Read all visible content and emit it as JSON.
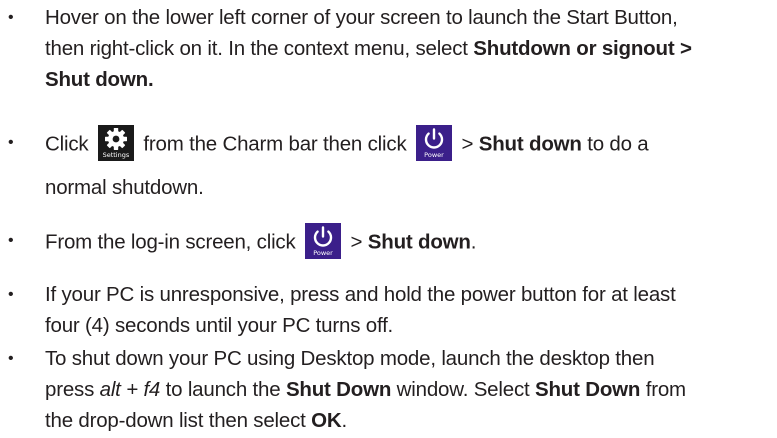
{
  "icons": {
    "settings_tile": "gear-icon",
    "power_tile": "power-icon",
    "settings_tile_color": "#1a1a1a",
    "power_tile_color": "#3b1f8a"
  },
  "items": [
    {
      "bullet": "•",
      "p1": "Hover on the lower left corner of your screen to launch the Start Button,",
      "p2": "then right-click on it. In the context menu, select ",
      "b1": "Shutdown or signout >",
      "b2": "Shut down."
    },
    {
      "bullet": "•",
      "p1": "Click ",
      "settings_caption": "Settings",
      "p2": " from  the Charm bar then click ",
      "power_caption": "Power",
      "p3": " > ",
      "b1": "Shut down",
      "p4": " to do a",
      "p5": "normal shutdown."
    },
    {
      "bullet": "•",
      "p1": "From the log-in screen, click ",
      "power_caption": "Power",
      "p2": " > ",
      "b1": "Shut down",
      "p3": "."
    },
    {
      "bullet": "•",
      "p1": "If your PC is unresponsive, press and hold the power button for at least",
      "p2": "four (4) seconds until your PC turns off."
    },
    {
      "bullet": "•",
      "p1": "To shut down your PC using Desktop mode, launch the desktop then",
      "p2": "press ",
      "i1": "alt + f4",
      "p3": " to launch the ",
      "b1": "Shut Down",
      "p4": " window. Select ",
      "b2": "Shut Down",
      "p5": " from",
      "p6": "the drop-down list then select ",
      "b3": "OK",
      "p7": "."
    }
  ]
}
